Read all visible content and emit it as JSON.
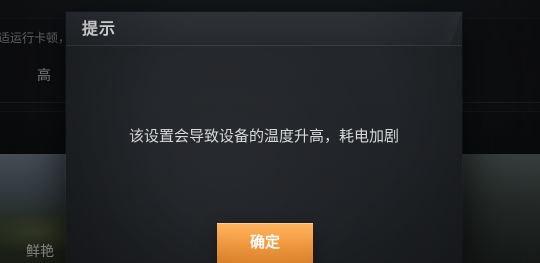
{
  "background": {
    "hint_text": "适运行卡顿，",
    "quality_label": "高",
    "thumbnail_left_label": "鲜艳"
  },
  "dialog": {
    "title": "提示",
    "message": "该设置会导致设备的温度升高，耗电加剧",
    "confirm_button": "确定"
  },
  "colors": {
    "dialog_bg": "#202327",
    "dialog_header_bg": "#2f3338",
    "button_accent": "#f29a3e",
    "text_primary": "#f2f2f2",
    "text_secondary": "#d9d9d9"
  }
}
